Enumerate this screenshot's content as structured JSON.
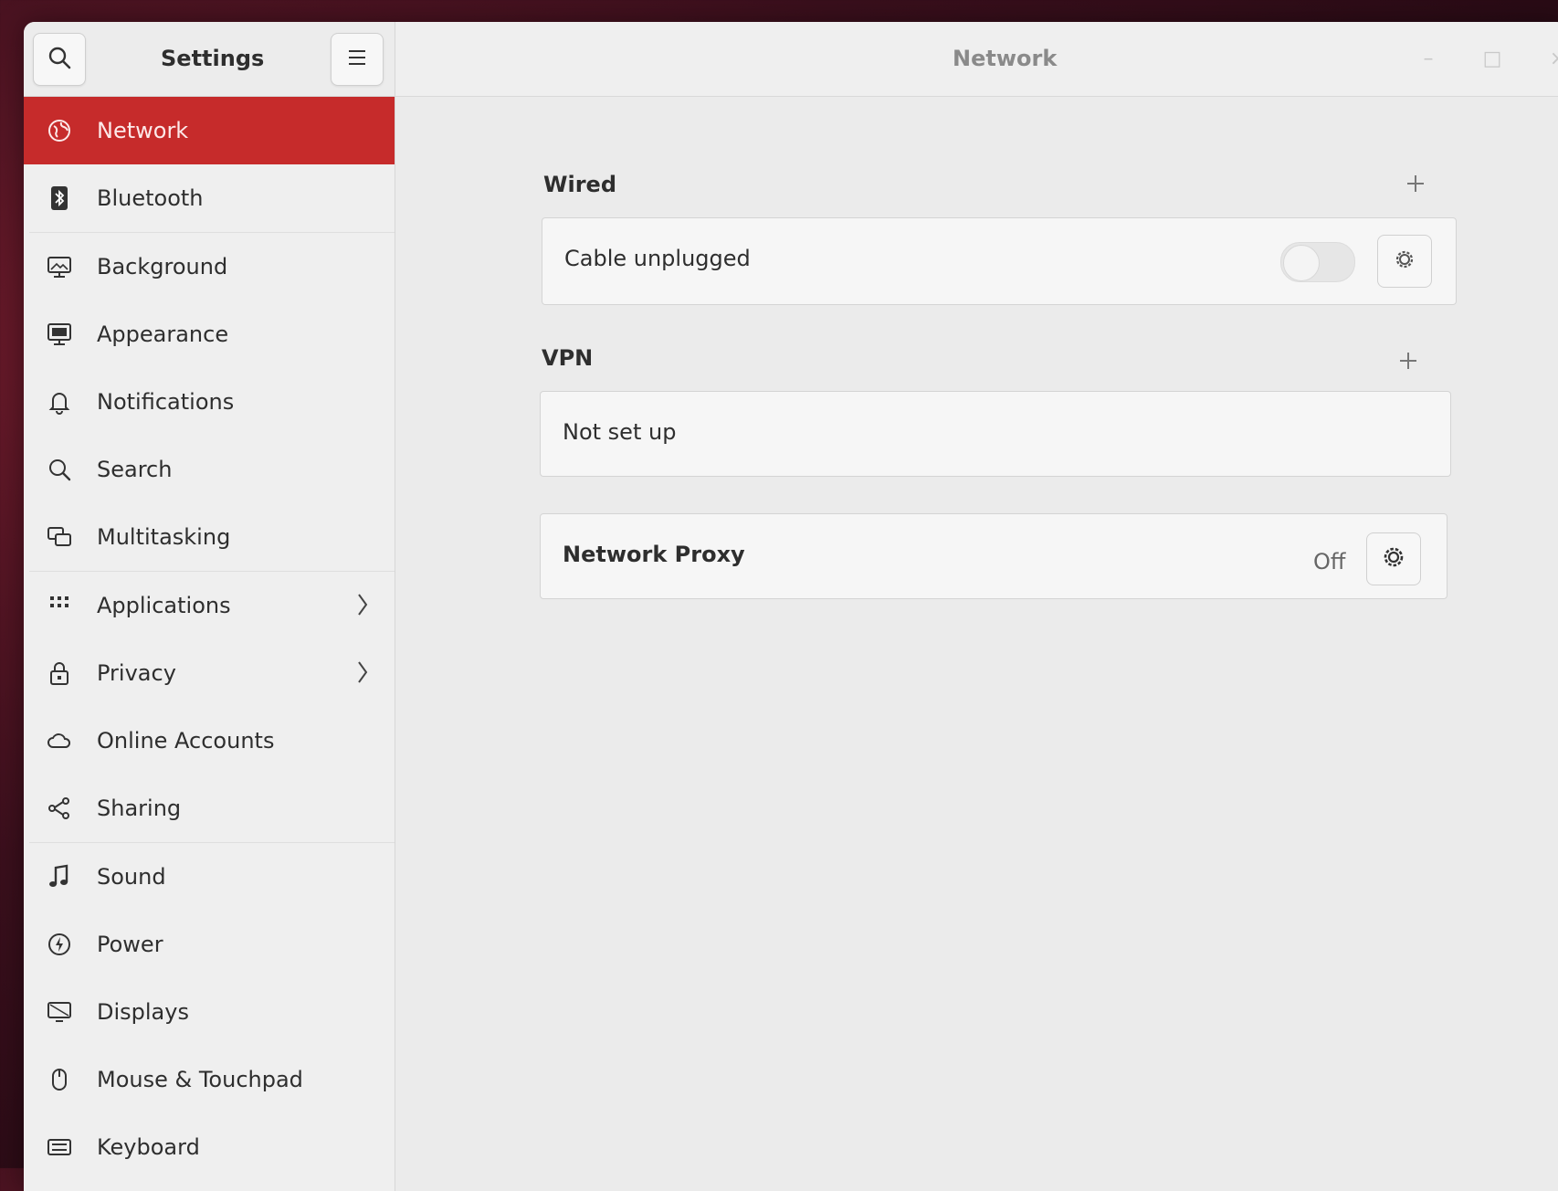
{
  "window": {
    "app_title": "Settings",
    "page_title": "Network",
    "controls": {
      "minimize": "–",
      "maximize": "□",
      "close": "×"
    }
  },
  "sidebar": {
    "items": [
      {
        "label": "Network",
        "icon": "network-icon",
        "active": true
      },
      {
        "label": "Bluetooth",
        "icon": "bluetooth-icon"
      },
      {
        "label": "Background",
        "icon": "background-icon"
      },
      {
        "label": "Appearance",
        "icon": "appearance-icon"
      },
      {
        "label": "Notifications",
        "icon": "bell-icon"
      },
      {
        "label": "Search",
        "icon": "search-icon"
      },
      {
        "label": "Multitasking",
        "icon": "multitasking-icon"
      },
      {
        "label": "Applications",
        "icon": "grid-icon",
        "has_submenu": true
      },
      {
        "label": "Privacy",
        "icon": "lock-icon",
        "has_submenu": true
      },
      {
        "label": "Online Accounts",
        "icon": "cloud-icon"
      },
      {
        "label": "Sharing",
        "icon": "share-icon"
      },
      {
        "label": "Sound",
        "icon": "music-note-icon"
      },
      {
        "label": "Power",
        "icon": "power-icon"
      },
      {
        "label": "Displays",
        "icon": "display-icon"
      },
      {
        "label": "Mouse & Touchpad",
        "icon": "mouse-icon"
      },
      {
        "label": "Keyboard",
        "icon": "keyboard-icon"
      }
    ]
  },
  "wired": {
    "title": "Wired",
    "status": "Cable unplugged",
    "toggle_on": false
  },
  "vpn": {
    "title": "VPN",
    "status": "Not set up"
  },
  "proxy": {
    "title": "Network Proxy",
    "status": "Off"
  }
}
